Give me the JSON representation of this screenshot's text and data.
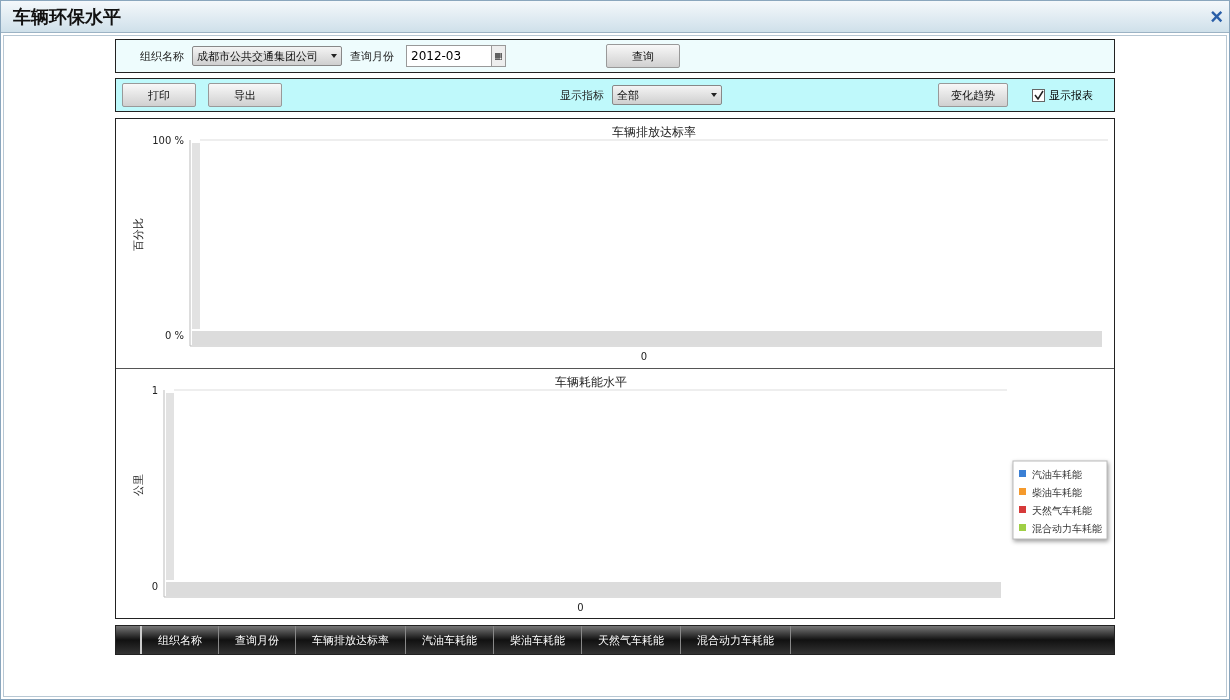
{
  "window": {
    "title": "车辆环保水平",
    "close": "×"
  },
  "query_bar": {
    "org_label": "组织名称",
    "org_value": "成都市公共交通集团公司",
    "month_label": "查询月份",
    "month_value": "2012-03",
    "query_button": "查询"
  },
  "toolbar": {
    "buttons": [
      "打印",
      "导出"
    ],
    "indicator_label": "显示指标",
    "indicator_value": "全部",
    "trend_button": "变化趋势",
    "show_report": {
      "label": "显示报表",
      "checked": true
    }
  },
  "charts": [
    {
      "chart_data": {
        "type": "bar",
        "title": "车辆排放达标率",
        "ylabel": "百分比",
        "categories": [
          "0"
        ],
        "values": [
          null
        ],
        "ylim": [
          0,
          1
        ],
        "yticks": [
          {
            "value": 0,
            "label": "0 %"
          },
          {
            "value": 1,
            "label": "100 %"
          }
        ]
      }
    },
    {
      "chart_data": {
        "type": "bar",
        "title": "车辆耗能水平",
        "ylabel": "公里",
        "categories": [
          "0"
        ],
        "series": [
          {
            "name": "汽油车耗能",
            "color": "#3a7fd5",
            "values": [
              null
            ]
          },
          {
            "name": "柴油车耗能",
            "color": "#f59a2c",
            "values": [
              null
            ]
          },
          {
            "name": "天然气车耗能",
            "color": "#d63a3a",
            "values": [
              null
            ]
          },
          {
            "name": "混合动力车耗能",
            "color": "#9fcf45",
            "values": [
              null
            ]
          }
        ],
        "ylim": [
          0,
          1
        ],
        "yticks": [
          0,
          1
        ]
      }
    }
  ],
  "table": {
    "columns": [
      "组织名称",
      "查询月份",
      "车辆排放达标率",
      "汽油车耗能",
      "柴油车耗能",
      "天然气车耗能",
      "混合动力车耗能"
    ]
  }
}
